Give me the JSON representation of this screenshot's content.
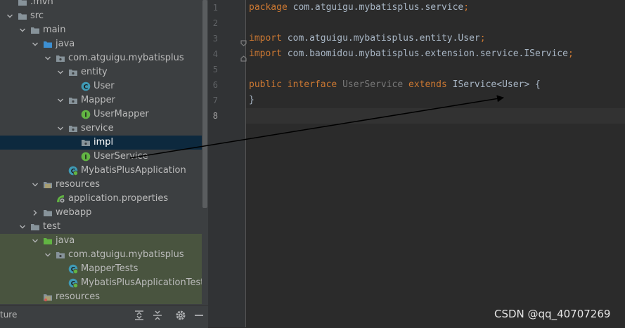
{
  "project_tree": {
    "items": [
      {
        "label": ".mvn",
        "depth": 0,
        "icon": "folder-icon",
        "expanded": null
      },
      {
        "label": "src",
        "depth": 0,
        "icon": "folder-icon",
        "expanded": true
      },
      {
        "label": "main",
        "depth": 1,
        "icon": "folder-icon",
        "expanded": true
      },
      {
        "label": "java",
        "depth": 2,
        "icon": "source-folder-icon",
        "expanded": true
      },
      {
        "label": "com.atguigu.mybatisplus",
        "depth": 3,
        "icon": "package-icon",
        "expanded": true
      },
      {
        "label": "entity",
        "depth": 4,
        "icon": "package-icon",
        "expanded": true
      },
      {
        "label": "User",
        "depth": 5,
        "icon": "class-icon",
        "expanded": null
      },
      {
        "label": "Mapper",
        "depth": 4,
        "icon": "package-icon",
        "expanded": true
      },
      {
        "label": "UserMapper",
        "depth": 5,
        "icon": "interface-icon",
        "expanded": null
      },
      {
        "label": "service",
        "depth": 4,
        "icon": "package-icon",
        "expanded": true
      },
      {
        "label": "impl",
        "depth": 5,
        "icon": "package-icon",
        "expanded": null,
        "selected": true
      },
      {
        "label": "UserService",
        "depth": 5,
        "icon": "interface-icon",
        "expanded": null
      },
      {
        "label": "MybatisPlusApplication",
        "depth": 4,
        "icon": "spring-boot-class-icon",
        "expanded": null
      },
      {
        "label": "resources",
        "depth": 2,
        "icon": "resources-folder-icon",
        "expanded": true
      },
      {
        "label": "application.properties",
        "depth": 3,
        "icon": "spring-properties-icon",
        "expanded": null
      },
      {
        "label": "webapp",
        "depth": 2,
        "icon": "folder-icon",
        "expanded": false
      },
      {
        "label": "test",
        "depth": 1,
        "icon": "folder-icon",
        "expanded": true
      },
      {
        "label": "java",
        "depth": 2,
        "icon": "test-source-folder-icon",
        "expanded": true,
        "test": true
      },
      {
        "label": "com.atguigu.mybatisplus",
        "depth": 3,
        "icon": "package-icon",
        "expanded": true,
        "test": true
      },
      {
        "label": "MapperTests",
        "depth": 4,
        "icon": "spring-boot-test-icon",
        "expanded": null,
        "test": true
      },
      {
        "label": "MybatisPlusApplicationTests",
        "depth": 4,
        "icon": "spring-boot-test-icon",
        "expanded": null,
        "test": true
      },
      {
        "label": "resources",
        "depth": 2,
        "icon": "test-resources-folder-icon",
        "expanded": null,
        "test": true
      }
    ]
  },
  "bottom_toolbar": {
    "title": "ture",
    "buttons": [
      "expand-all-icon",
      "collapse-all-icon",
      "gear-icon",
      "minimize-icon"
    ]
  },
  "editor": {
    "current_line": 8,
    "lines": [
      {
        "n": "1",
        "tokens": [
          {
            "t": "package ",
            "c": "kw"
          },
          {
            "t": "com.atguigu.mybatisplus.service",
            "c": ""
          },
          {
            "t": ";",
            "c": "kw"
          }
        ]
      },
      {
        "n": "2",
        "tokens": []
      },
      {
        "n": "3",
        "tokens": [
          {
            "t": "import ",
            "c": "kw"
          },
          {
            "t": "com.atguigu.mybatisplus.entity.User",
            "c": ""
          },
          {
            "t": ";",
            "c": "kw"
          }
        ],
        "fold": true
      },
      {
        "n": "4",
        "tokens": [
          {
            "t": "import ",
            "c": "kw"
          },
          {
            "t": "com.baomidou.mybatisplus.extension.service.IService",
            "c": ""
          },
          {
            "t": ";",
            "c": "kw"
          }
        ],
        "fold": true
      },
      {
        "n": "5",
        "tokens": []
      },
      {
        "n": "6",
        "tokens": [
          {
            "t": "public ",
            "c": "kw"
          },
          {
            "t": "interface ",
            "c": "kw"
          },
          {
            "t": "UserService ",
            "c": "sub"
          },
          {
            "t": "extends ",
            "c": "kw"
          },
          {
            "t": "IService<User> {",
            "c": ""
          }
        ]
      },
      {
        "n": "7",
        "tokens": [
          {
            "t": "}",
            "c": ""
          }
        ]
      },
      {
        "n": "8",
        "tokens": []
      }
    ]
  },
  "watermark": "CSDN @qq_40707269",
  "colors": {
    "tree_bg": "#3c3f41",
    "editor_bg": "#2b2b2b",
    "keyword": "#cc7832",
    "identifier": "#a9b7c6",
    "selection": "#0d293e",
    "test_bg": "#49543f"
  }
}
